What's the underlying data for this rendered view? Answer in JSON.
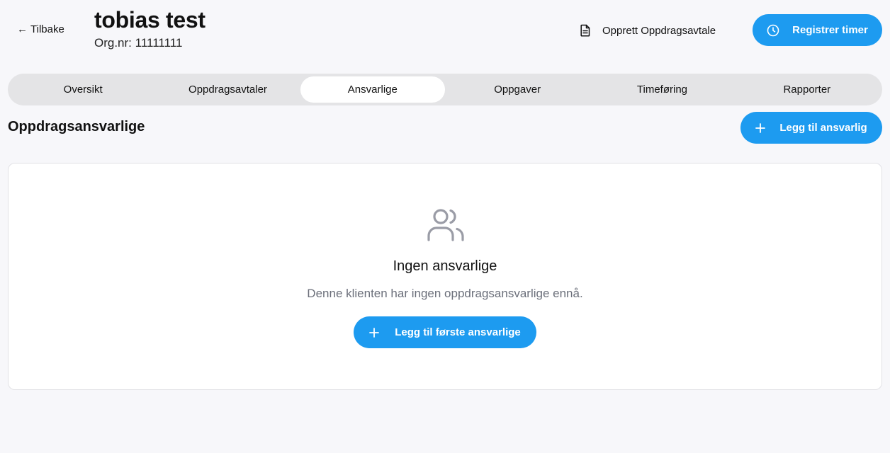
{
  "header": {
    "back_label": "Tilbake",
    "back_arrow": "←",
    "client_name": "tobias test",
    "org_nr": "Org.nr: 11111111",
    "agreement_label": "Opprett Oppdragsavtale",
    "agreement_icon": "document-icon",
    "register_label": "Registrer timer",
    "register_icon": "clock-icon"
  },
  "tabs": [
    {
      "label": "Oversikt",
      "active": false
    },
    {
      "label": "Oppdragsavtaler",
      "active": false
    },
    {
      "label": "Ansvarlige",
      "active": true
    },
    {
      "label": "Oppgaver",
      "active": false
    },
    {
      "label": "Timeføring",
      "active": false
    },
    {
      "label": "Rapporter",
      "active": false
    }
  ],
  "section": {
    "title": "Oppdragsansvarlige",
    "add_label": "Legg til ansvarlig",
    "add_icon": "plus-icon"
  },
  "empty_state": {
    "icon": "users-icon",
    "title": "Ingen ansvarlige",
    "description": "Denne klienten har ingen oppdragsansvarlige ennå.",
    "button_label": "Legg til første ansvarlige",
    "button_icon": "plus-icon"
  },
  "colors": {
    "accent": "#1d9bf0",
    "background": "#f7f7fa",
    "tab_bar": "#e4e4e6",
    "muted_text": "#6b6f7a",
    "icon_gray": "#9a9ca6"
  }
}
